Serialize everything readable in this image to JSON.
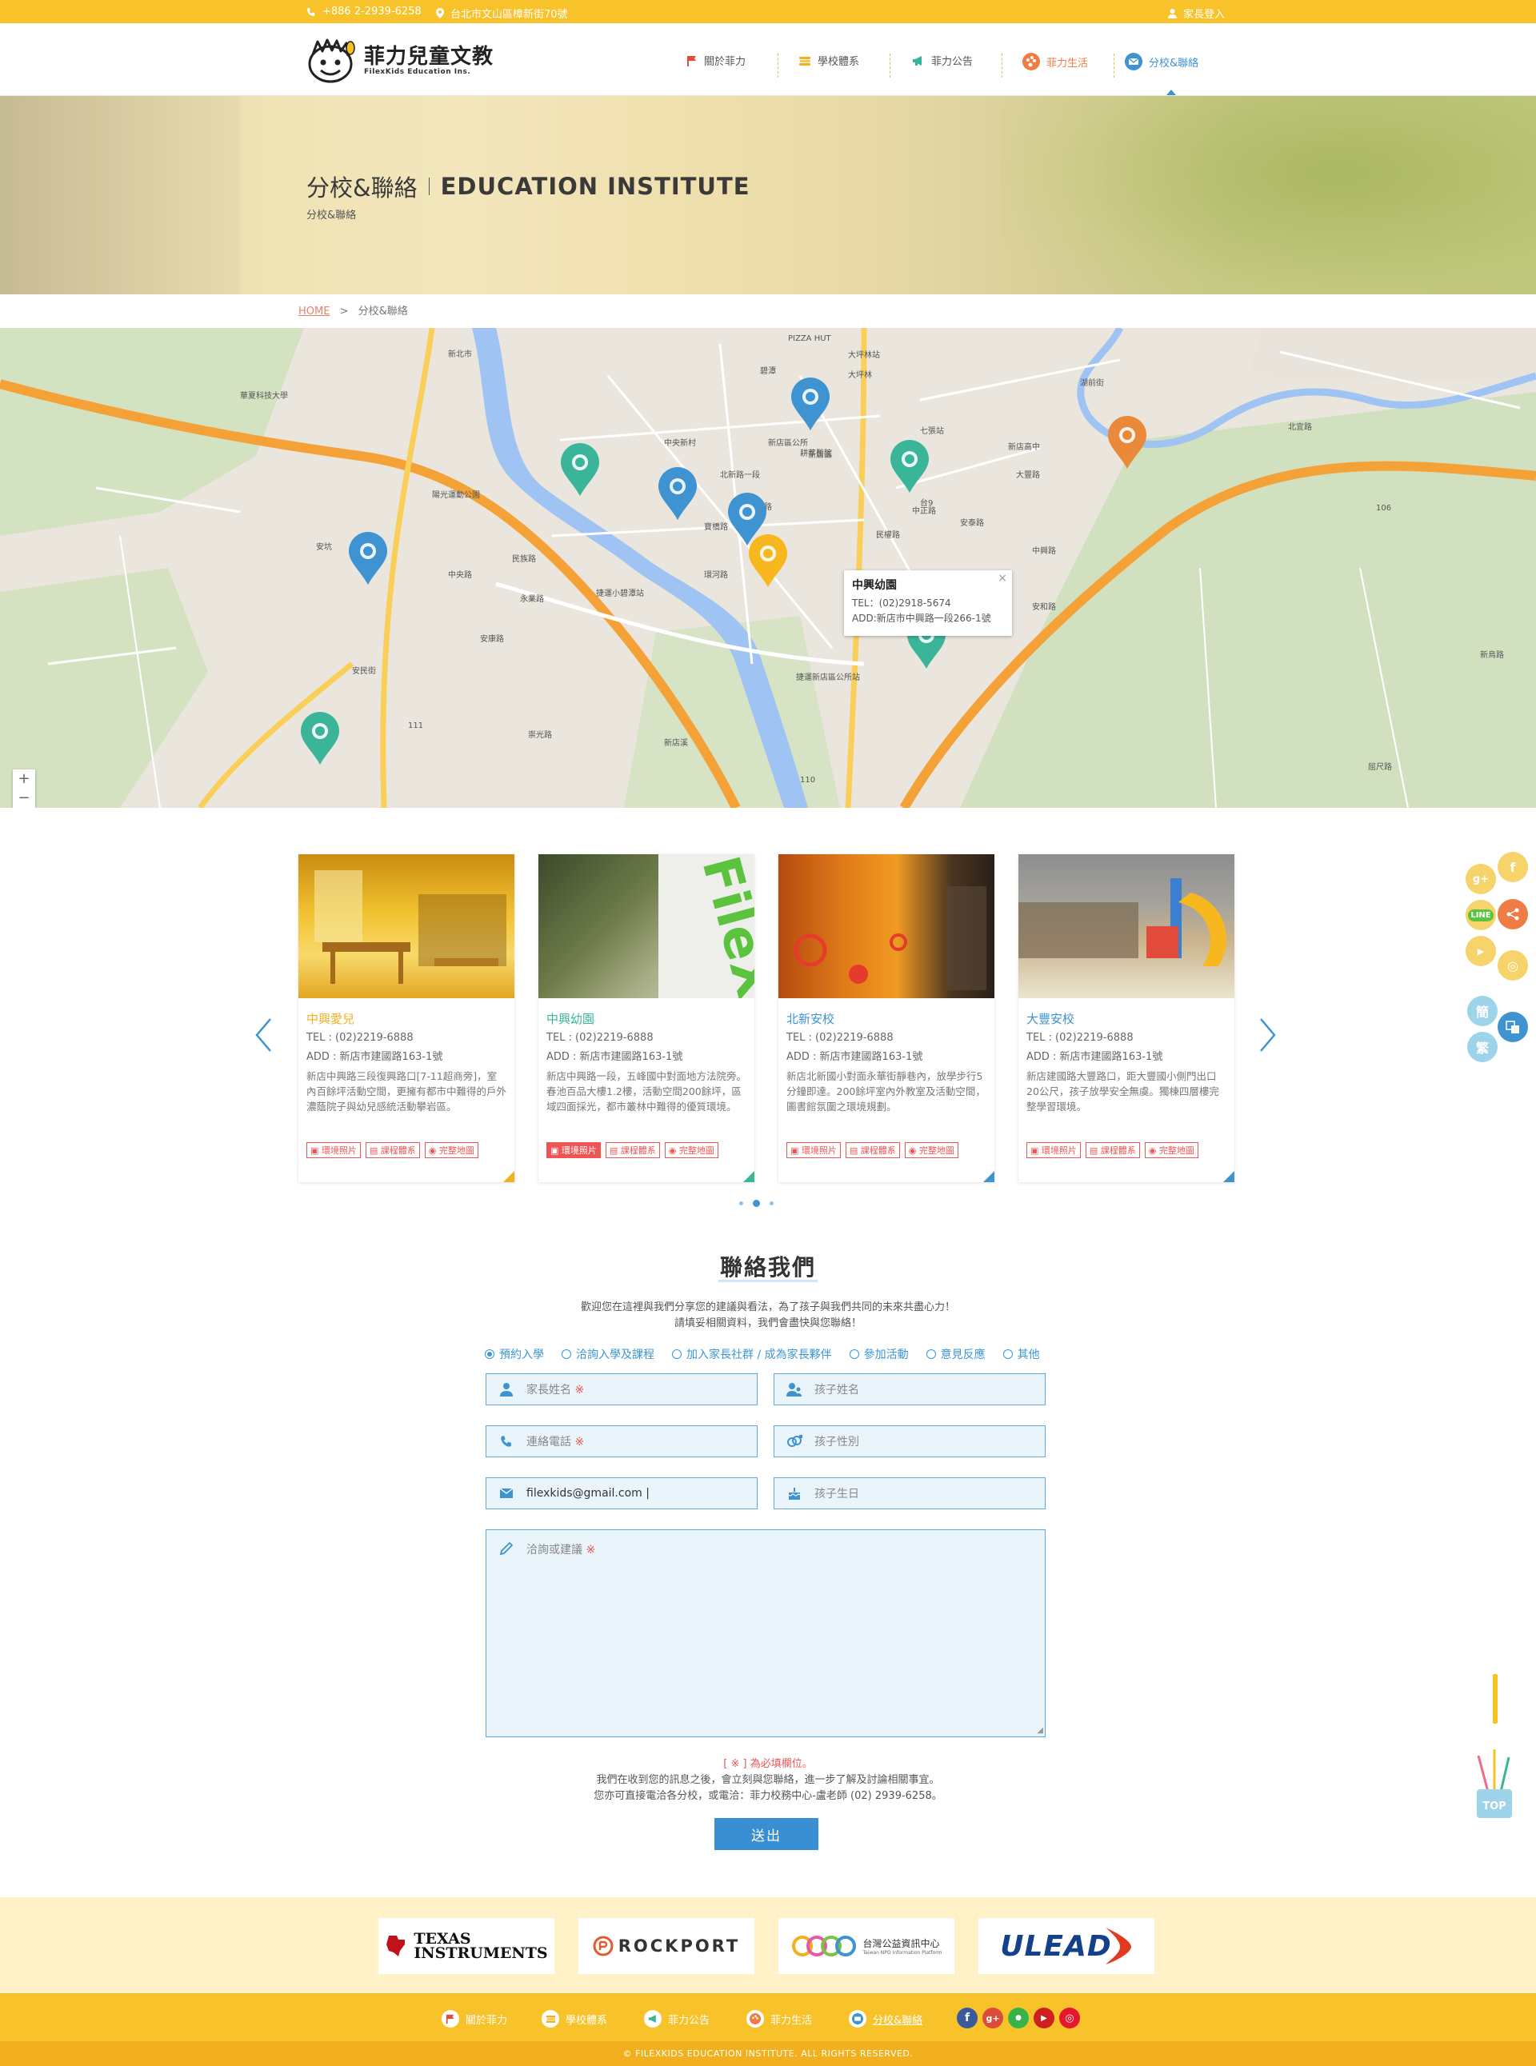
{
  "topbar": {
    "phone": "+886 2-2939-6258",
    "address": "台北市文山區樟新街70號",
    "login": "家長登入"
  },
  "logo": {
    "zh": "菲力兒童文教",
    "en": "FilexKids Education Ins."
  },
  "nav": [
    {
      "label": "關於菲力",
      "icon": "flag-icon"
    },
    {
      "label": "學校體系",
      "icon": "book-stack-icon"
    },
    {
      "label": "菲力公告",
      "icon": "megaphone-icon"
    },
    {
      "label": "菲力生活",
      "icon": "palette-icon"
    },
    {
      "label": "分校&聯絡",
      "icon": "mail-icon"
    }
  ],
  "hero": {
    "title_zh": "分校&聯絡",
    "title_en": "EDUCATION INSTITUTE",
    "subtitle": "分校&聯絡"
  },
  "breadcrumb": {
    "home": "HOME",
    "sep": ">",
    "current": "分校&聯絡"
  },
  "map": {
    "labels": [
      "新北市",
      "華夏科技大學",
      "碧潭",
      "新店區",
      "大坪林",
      "中央新村",
      "陽光運動公園",
      "安坑",
      "北新路",
      "捷運小碧潭站",
      "捷運新店區公所站",
      "中正路",
      "環河路",
      "北宜路",
      "大豐路",
      "安民街",
      "安康路",
      "中興路",
      "崇光路",
      "新烏路",
      "安泰路",
      "新店溪",
      "台9",
      "106",
      "110",
      "111",
      "PIZZA HUT",
      "新店區公所",
      "大坪林站",
      "七張站",
      "新店高中",
      "耕莘醫院",
      "中央路",
      "永業路",
      "北新路一段",
      "安和路",
      "湖前街",
      "屈尺路",
      "寶橋路",
      "民權路",
      "民族路",
      "三民路"
    ],
    "popup": {
      "title": "中興幼園",
      "tel": "TEL：(02)2918-5674",
      "addr": "ADD:新店市中興路一段266-1號",
      "close": "×"
    },
    "zoom_in": "+",
    "zoom_out": "−",
    "colors": {
      "blue": "#3e93d0",
      "teal": "#3bb59a",
      "orange": "#e98a3a",
      "gold": "#f6b81e"
    }
  },
  "schools": [
    {
      "name": "中興愛兒",
      "tel": "TEL : (02)2219-6888",
      "addr": "ADD : 新店市建國路163-1號",
      "desc": "新店中興路三段復興路口[7-11超商旁]，室內百餘坪活動空間，更擁有都市中難得的戶外濃蔭院子與幼兒感統活動攀岩區。",
      "color": "#f2b01e",
      "btns": [
        "環境照片",
        "課程體系",
        "完整地圖"
      ]
    },
    {
      "name": "中興幼園",
      "tel": "TEL : (02)2219-6888",
      "addr": "ADD : 新店市建國路163-1號",
      "desc": "新店中興路一段，五峰國中對面地方法院旁。春池百品大樓1.2樓，活動空間200餘坪，區域四面採光，都市叢林中難得的優質環境。",
      "color": "#3bb59a",
      "btns": [
        "環境照片",
        "課程體系",
        "完整地圖"
      ]
    },
    {
      "name": "北新安校",
      "tel": "TEL : (02)2219-6888",
      "addr": "ADD : 新店市建國路163-1號",
      "desc": "新店北新國小對面永華街靜巷內，放學步行5分鐘即達。200餘坪室內外教室及活動空間，圖書館氛圍之環境規劃。",
      "color": "#3e93d0",
      "btns": [
        "環境照片",
        "課程體系",
        "完整地圖"
      ]
    },
    {
      "name": "大豐安校",
      "tel": "TEL : (02)2219-6888",
      "addr": "ADD : 新店市建國路163-1號",
      "desc": "新店建國路大豐路口，距大豐國小側門出口20公尺，孩子放學安全無虞。獨棟四層樓完整學習環境。",
      "color": "#3e93d0",
      "btns": [
        "環境照片",
        "課程體系",
        "完整地圖"
      ]
    }
  ],
  "side": {
    "simplified": "簡",
    "traditional": "繁",
    "top": "TOP"
  },
  "contact": {
    "title": "聯絡我們",
    "intro1": "歡迎您在這裡與我們分享您的建議與看法，為了孩子與我們共同的未來共盡心力！",
    "intro2": "請填妥相關資料，我們會盡快與您聯絡！",
    "types": [
      "預約入學",
      "洽詢入學及課程",
      "加入家長社群 / 成為家長夥伴",
      "參加活動",
      "意見反應",
      "其他"
    ],
    "fields": {
      "parent": "家長姓名",
      "child": "孩子姓名",
      "phone": "連絡電話",
      "gender": "孩子性別",
      "email_value": "filexkids@gmail.com |",
      "birthday": "孩子生日",
      "message": "洽詢或建議",
      "req": "※"
    },
    "required_note": "[ ※ ] 為必填欄位。",
    "note2": "我們在收到您的訊息之後，會立刻與您聯絡，進一步了解及討論相關事宜。",
    "note3": "您亦可直接電洽各分校，或電洽：菲力校務中心-盧老師 (02) 2939-6258。",
    "submit": "送出"
  },
  "partners": [
    {
      "name": "Texas Instruments",
      "line1": "TEXAS",
      "line2": "INSTRUMENTS"
    },
    {
      "name": "ROCKPORT"
    },
    {
      "name": "台灣公益資訊中心",
      "en": "Taiwan NPO Information Platform"
    },
    {
      "name": "ULEAD"
    }
  ],
  "footer": {
    "nav": [
      "關於菲力",
      "學校體系",
      "菲力公告",
      "菲力生活",
      "分校&聯絡"
    ],
    "copyright": "© FILEXKIDS EDUCATION INSTITUTE. ALL RIGHTS RESERVED."
  }
}
